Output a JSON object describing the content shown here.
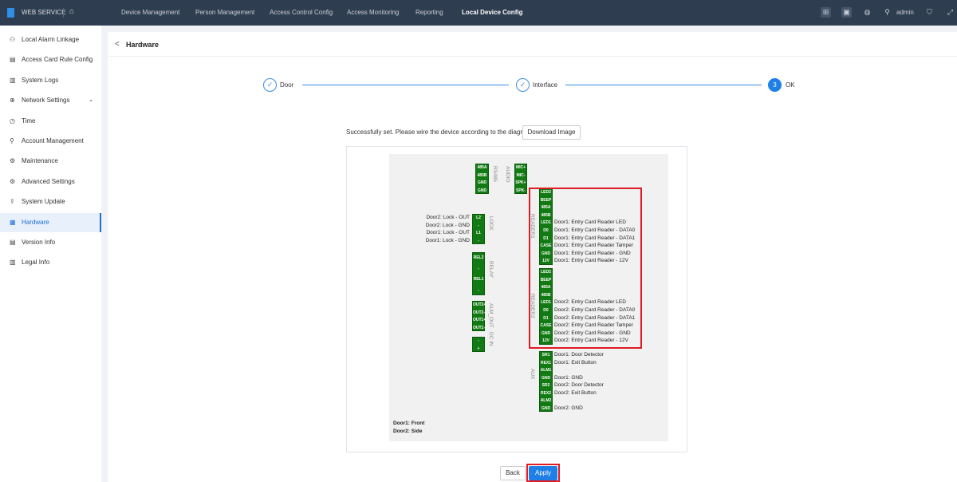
{
  "header": {
    "brand": "WEB SERVICE",
    "nav": [
      "Device Management",
      "Person Management",
      "Access Control Config",
      "Access Monitoring",
      "Reporting",
      "Local Device Config"
    ],
    "active_nav": "Local Device Config",
    "user": "admin"
  },
  "sidebar": {
    "items": [
      {
        "label": "Local Alarm Linkage",
        "icon": "alarm-linkage-icon",
        "glyph": "⚇"
      },
      {
        "label": "Access Card Rule Config",
        "icon": "card-rule-icon",
        "glyph": "▤"
      },
      {
        "label": "System Logs",
        "icon": "book-icon",
        "glyph": "▥"
      },
      {
        "label": "Network Settings",
        "icon": "globe-icon",
        "glyph": "⊕",
        "expandable": true
      },
      {
        "label": "Time",
        "icon": "clock-icon",
        "glyph": "◷"
      },
      {
        "label": "Account Management",
        "icon": "user-icon",
        "glyph": "⚲"
      },
      {
        "label": "Maintenance",
        "icon": "wrench-icon",
        "glyph": "⚙"
      },
      {
        "label": "Advanced Settings",
        "icon": "gear-icon",
        "glyph": "⚙"
      },
      {
        "label": "System Update",
        "icon": "upload-icon",
        "glyph": "⇪"
      },
      {
        "label": "Hardware",
        "icon": "hardware-icon",
        "glyph": "▦",
        "active": true
      },
      {
        "label": "Version Info",
        "icon": "info-icon",
        "glyph": "▤"
      },
      {
        "label": "Legal Info",
        "icon": "legal-icon",
        "glyph": "▥"
      }
    ]
  },
  "page": {
    "title": "Hardware",
    "steps": [
      {
        "label": "Door",
        "state": "done"
      },
      {
        "label": "Interface",
        "state": "done"
      },
      {
        "label": "OK",
        "number": "3",
        "state": "current"
      }
    ],
    "message": "Successfully set. Please wire the device according to the diagram.",
    "download_label": "Download Image",
    "back_label": "Back",
    "apply_label": "Apply"
  },
  "diagram": {
    "blocks": [
      {
        "id": "rs485",
        "title": "RS485",
        "pins": [
          "485A",
          "485B",
          "GND",
          "GND"
        ]
      },
      {
        "id": "audio",
        "title": "AUDIO",
        "pins": [
          "MIC+",
          "MIC-",
          "SPK+",
          "SPK-"
        ]
      },
      {
        "id": "lock",
        "title": "LOCK",
        "pins": [
          "L2",
          "-",
          "L1",
          "-"
        ],
        "labels": [
          "Door2: Lock - OUT",
          "Door2: Lock - GND",
          "Door1: Lock - OUT",
          "Door1: Lock - GND"
        ]
      },
      {
        "id": "relay",
        "title": "RELAY",
        "pins": [
          "REL2",
          "-",
          "REL1",
          "-"
        ]
      },
      {
        "id": "almout",
        "title": "ALM_OUT",
        "pins": [
          "OUT2+",
          "OUT2-",
          "OUT1+",
          "OUT1-"
        ]
      },
      {
        "id": "dcin",
        "title": "DC IN",
        "pins": [
          "-",
          "+"
        ]
      },
      {
        "id": "reader1",
        "title": "READER1",
        "pins": [
          "LED2",
          "BEEP",
          "485A",
          "485B",
          "LED1",
          "D0",
          "D1",
          "CASE",
          "GND",
          "12V"
        ],
        "labels": [
          "",
          "",
          "",
          "",
          "Door1: Entry Card Reader LED",
          "Door1: Entry Card Reader - DATA0",
          "Door1: Entry Card Reader - DATA1",
          "Door1: Entry Card Reader Tamper",
          "Door1: Entry Card Reader - GND",
          "Door1: Entry Card Reader - 12V"
        ]
      },
      {
        "id": "reader2",
        "title": "READER2",
        "pins": [
          "LED2",
          "BEEP",
          "485A",
          "485B",
          "LED1",
          "D0",
          "D1",
          "CASE",
          "GND",
          "12V"
        ],
        "labels": [
          "",
          "",
          "",
          "",
          "Door2: Entry Card Reader LED",
          "Door2: Entry Card Reader - DATA0",
          "Door2: Entry Card Reader - DATA1",
          "Door2: Entry Card Reader Tamper",
          "Door2: Entry Card Reader - GND",
          "Door2: Entry Card Reader - 12V"
        ]
      },
      {
        "id": "aux",
        "title": "AUX",
        "pins": [
          "SR1",
          "REX1",
          "ALM1",
          "GND",
          "SR2",
          "REX2",
          "ALM2",
          "GND"
        ],
        "labels": [
          "Door1: Door Detector",
          "Door1: Exit Button",
          "",
          "Door1: GND",
          "Door2: Door Detector",
          "Door2: Exit Button",
          "",
          "Door2: GND"
        ]
      }
    ],
    "notes": [
      "Door1: Front",
      "Door2: Side"
    ],
    "highlight_color": "#e01b24",
    "terminal_color": "#127a12"
  },
  "colors": {
    "accent": "#1e7fe6",
    "topbar": "#2e3d4f"
  }
}
